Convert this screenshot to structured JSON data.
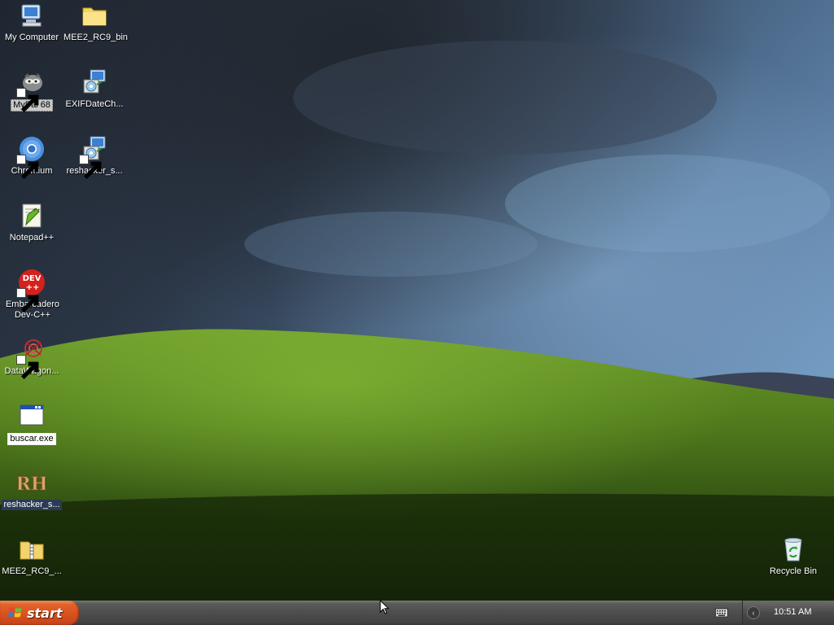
{
  "desktop": {
    "icons": [
      {
        "label": "My Computer",
        "icon": "computer-icon"
      },
      {
        "label": "MEE2_RC9_bin",
        "icon": "folder-icon"
      },
      {
        "label": "MyPal 68",
        "icon": "mypal-icon"
      },
      {
        "label": "EXIFDateCh...",
        "icon": "installer-icon"
      },
      {
        "label": "Chromium",
        "icon": "chromium-icon"
      },
      {
        "label": "reshacker_s...",
        "icon": "installer-icon"
      },
      {
        "label": "Notepad++",
        "icon": "notepad-plus-plus-icon"
      },
      {
        "label": "Embarcadero Dev-C++",
        "icon": "dev-cpp-icon",
        "badge": "DEV\n++"
      },
      {
        "label": "DataWagon...",
        "icon": "datawagon-icon"
      },
      {
        "label": "buscar.exe",
        "icon": "exe-window-icon"
      },
      {
        "label": "reshacker_s...",
        "icon": "resource-hacker-icon",
        "badge": "RH"
      },
      {
        "label": "MEE2_RC9_...",
        "icon": "zip-folder-icon"
      },
      {
        "label": "Recycle Bin",
        "icon": "recycle-bin-icon"
      }
    ]
  },
  "taskbar": {
    "start_label": "start",
    "clock": "10:51 AM",
    "tray_arrow": "‹"
  },
  "colors": {
    "start_orange": "#d8521d",
    "taskbar_gray": "#4d4d4d"
  }
}
